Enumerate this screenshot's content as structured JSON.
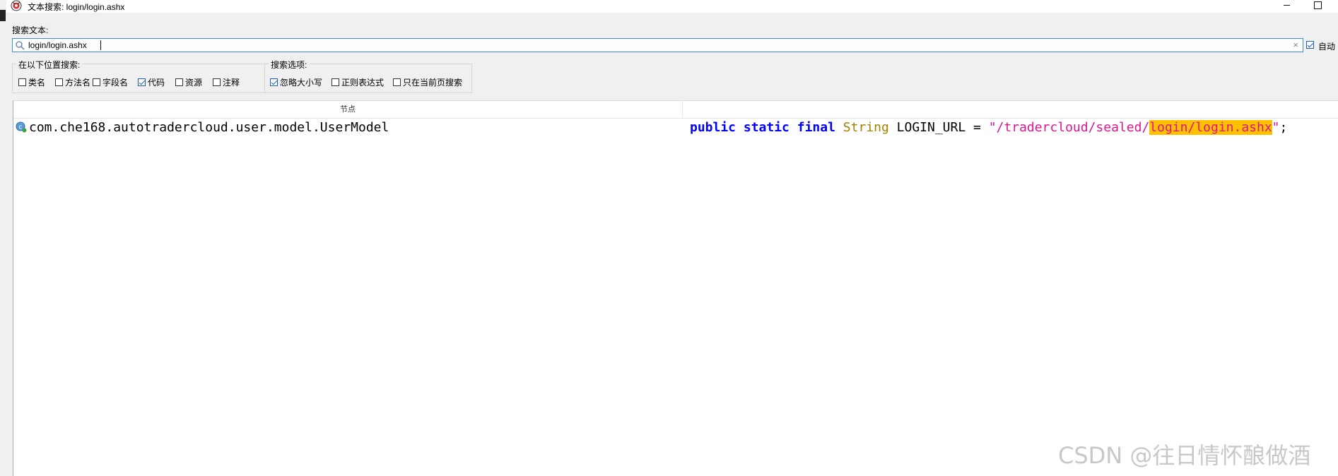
{
  "window": {
    "title": "文本搜索: login/login.ashx"
  },
  "search": {
    "label": "搜索文本:",
    "value": "login/login.ashx",
    "clear_symbol": "×",
    "auto_label": "自动",
    "auto_checked": true
  },
  "search_locations": {
    "title": "在以下位置搜索:",
    "options": [
      {
        "label": "类名",
        "checked": false
      },
      {
        "label": "方法名",
        "checked": false
      },
      {
        "label": "字段名",
        "checked": false
      },
      {
        "label": "代码",
        "checked": true
      },
      {
        "label": "资源",
        "checked": false
      },
      {
        "label": "注释",
        "checked": false
      }
    ]
  },
  "search_options": {
    "title": "搜索选项:",
    "options": [
      {
        "label": "忽略大小写",
        "checked": true
      },
      {
        "label": "正则表达式",
        "checked": false
      },
      {
        "label": "只在当前页搜索",
        "checked": false
      }
    ]
  },
  "results": {
    "column_node": "节点",
    "rows": [
      {
        "node": "com.che168.autotradercloud.user.model.UserModel",
        "code": {
          "kw1": "public",
          "kw2": "static",
          "kw3": "final",
          "type": "String",
          "name": "LOGIN_URL = ",
          "str_start": "\"/tradercloud/sealed/",
          "str_match": "login/login.ashx",
          "str_end": "\"",
          "tail": ";"
        }
      }
    ]
  },
  "watermark": "CSDN @往日情怀酿做酒",
  "colors": {
    "keyword": "#0000ff",
    "type": "#a08300",
    "string": "#e0138f",
    "highlight": "#ffc000",
    "accent": "#3c8ed8"
  },
  "icons": {
    "app": "jadx-logo-icon",
    "search": "search-icon",
    "class": "class-icon"
  }
}
